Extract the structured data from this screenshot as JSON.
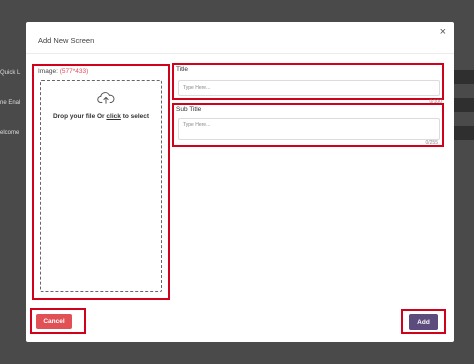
{
  "background": {
    "rows": [
      "Quick L",
      "ne Enal",
      "elcome"
    ]
  },
  "modal": {
    "title": "Add New Screen",
    "close_icon": "×",
    "image": {
      "label": "Image:",
      "dimensions": "(577*433)",
      "drop_text_before": "Drop your file Or",
      "drop_click": "click",
      "drop_text_after": "to select"
    },
    "title_field": {
      "label": "Title",
      "placeholder": "Type Here...",
      "value": "",
      "counter": "0/100"
    },
    "subtitle_field": {
      "label": "Sub Title",
      "placeholder": "Type Here...",
      "value": "",
      "counter": "0/255"
    },
    "cancel_label": "Cancel",
    "add_label": "Add"
  },
  "colors": {
    "overlay": "#4a4a4a",
    "highlight": "#d0021b",
    "cancel": "#e05055",
    "add": "#5c4b7d"
  },
  "icons": {
    "close": "close-icon",
    "upload": "cloud-upload-icon"
  }
}
